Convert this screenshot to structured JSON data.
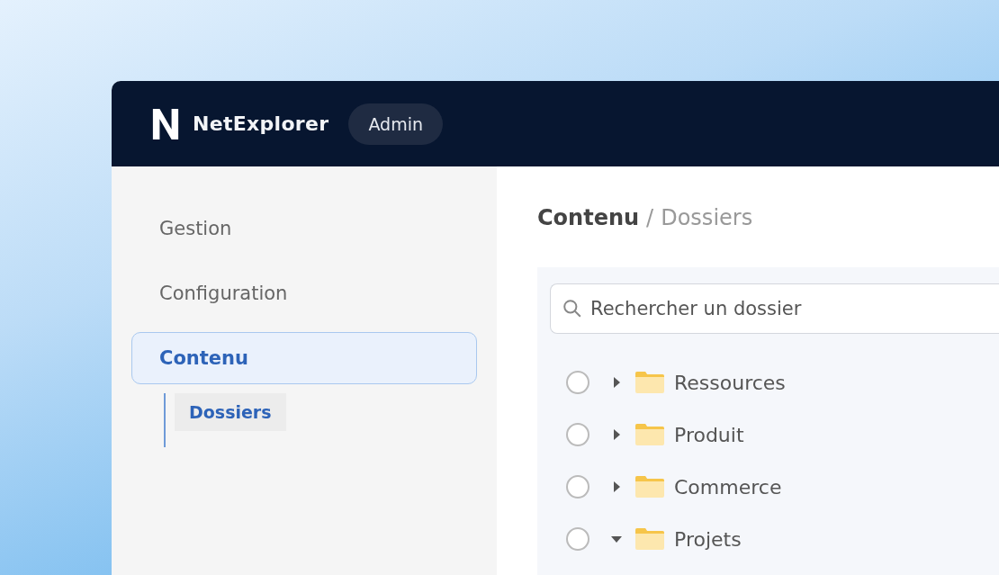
{
  "header": {
    "app_name": "NetExplorer",
    "role_badge": "Admin"
  },
  "sidebar": {
    "items": [
      {
        "label": "Gestion",
        "selected": false
      },
      {
        "label": "Configuration",
        "selected": false
      },
      {
        "label": "Contenu",
        "selected": true,
        "children": [
          {
            "label": "Dossiers",
            "selected": true
          }
        ]
      }
    ]
  },
  "breadcrumb": {
    "items": [
      "Contenu",
      "Dossiers"
    ],
    "separator": "/"
  },
  "search": {
    "placeholder": "Rechercher un dossier"
  },
  "folders": [
    {
      "name": "Ressources",
      "selected": false,
      "expanded": false
    },
    {
      "name": "Produit",
      "selected": false,
      "expanded": false
    },
    {
      "name": "Commerce",
      "selected": false,
      "expanded": false
    },
    {
      "name": "Projets",
      "selected": false,
      "expanded": true
    }
  ]
}
